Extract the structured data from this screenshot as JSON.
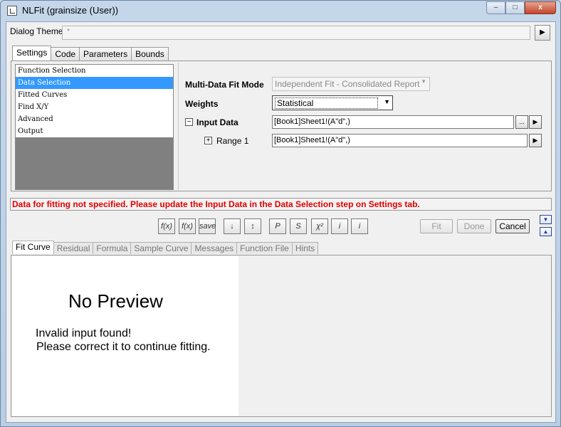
{
  "window": {
    "title": "NLFit (grainsize (User))",
    "controls": {
      "minimize": "–",
      "maximize": "□",
      "close": "x"
    }
  },
  "theme": {
    "label": "Dialog Theme",
    "value": "*",
    "arrow": "▶"
  },
  "top_tabs": [
    "Settings",
    "Code",
    "Parameters",
    "Bounds"
  ],
  "tree_items": [
    "Function Selection",
    "Data Selection",
    "Fitted Curves",
    "Find X/Y",
    "Advanced",
    "Output"
  ],
  "settings": {
    "fit_mode_label": "Multi-Data Fit Mode",
    "fit_mode_value": "Independent Fit - Consolidated Report",
    "weights_label": "Weights",
    "weights_value": "Statistical",
    "input_label": "Input Data",
    "input_value": "[Book1]Sheet1!(A\"d\",)",
    "range_label": "Range 1",
    "range_value": "[Book1]Sheet1!(A\"d\",)",
    "expander_minus": "−",
    "expander_plus": "+",
    "browse": "...",
    "arrow": "▶",
    "dropdown": "▼"
  },
  "error_message": "Data for fitting not specified. Please update the Input Data in the Data Selection step on Settings tab.",
  "toolbar_icons": [
    "f(x)",
    "f(x)",
    "save",
    "↓",
    "↕",
    "P",
    "S",
    "χ²",
    "i",
    "i"
  ],
  "buttons": {
    "fit": "Fit",
    "done": "Done",
    "cancel": "Cancel",
    "down": "▼",
    "up": "▲"
  },
  "bottom_tabs": [
    "Fit Curve",
    "Residual",
    "Formula",
    "Sample Curve",
    "Messages",
    "Function File",
    "Hints"
  ],
  "preview": {
    "title": "No Preview",
    "line1": "Invalid input found!",
    "line2": "Please correct it to continue fitting."
  }
}
